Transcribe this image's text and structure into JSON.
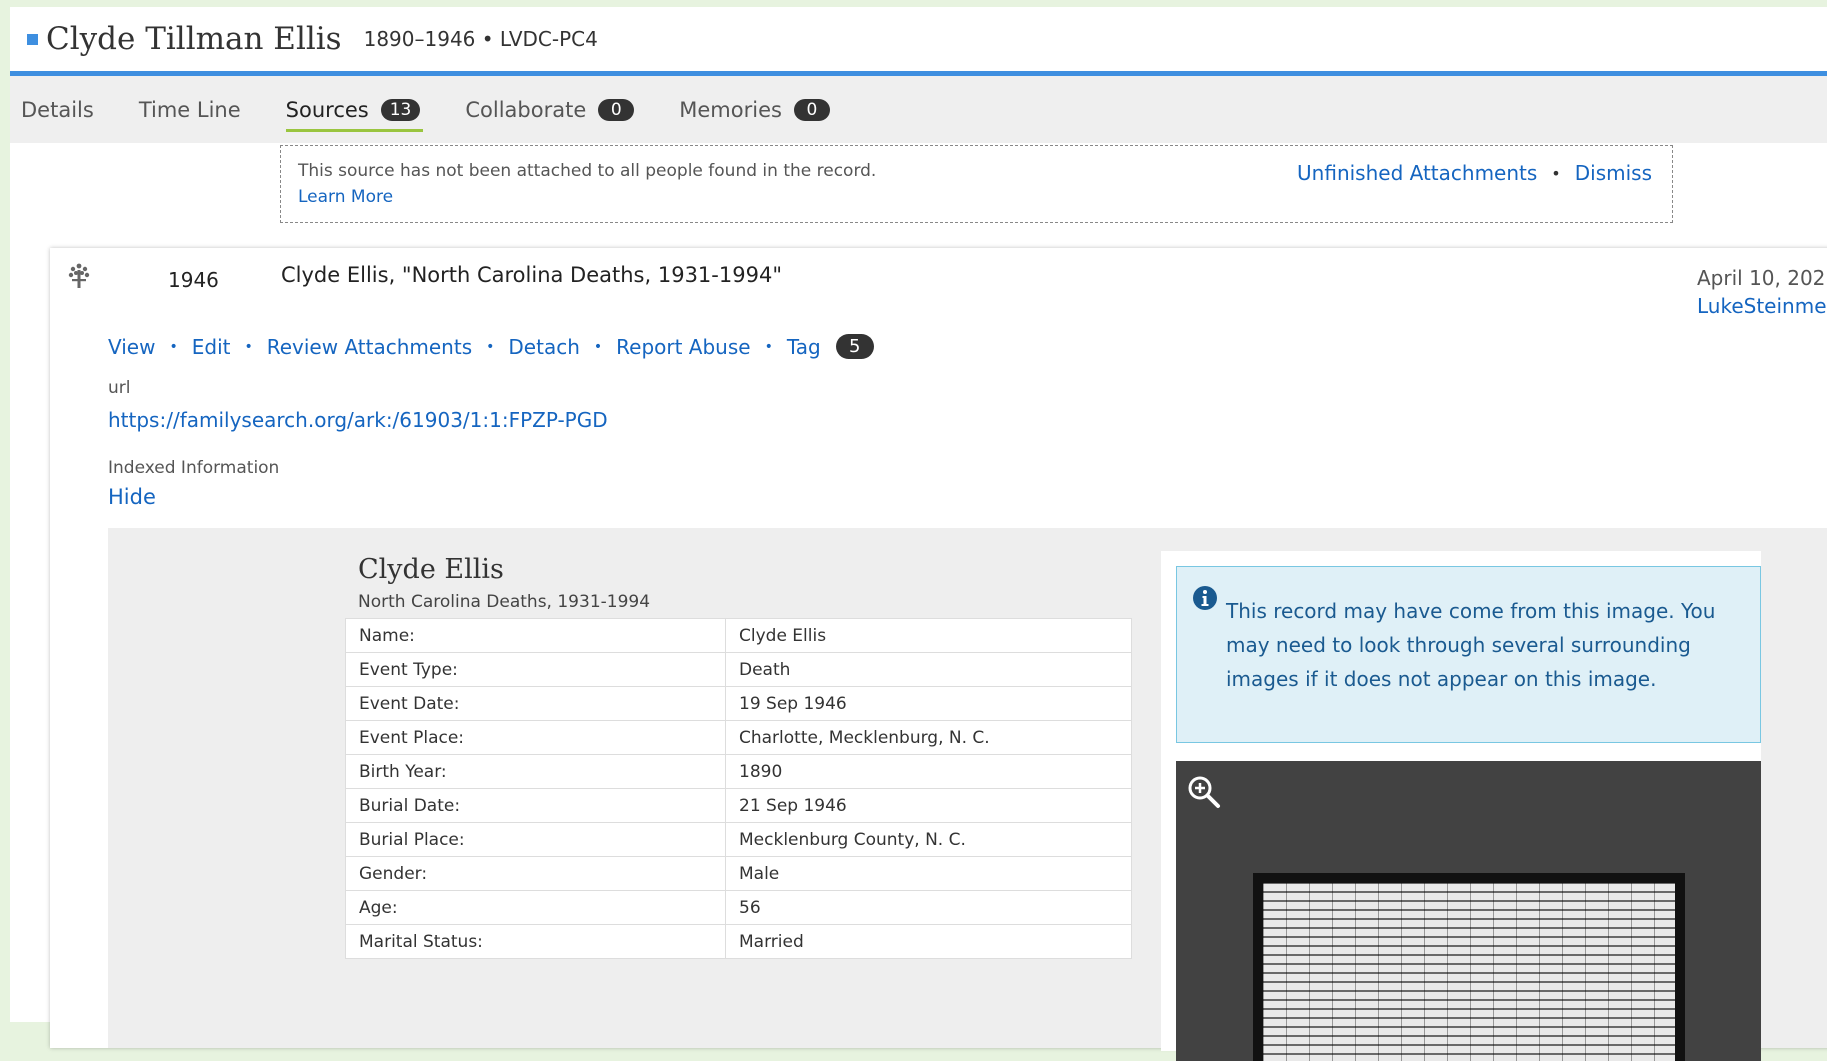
{
  "header": {
    "name": "Clyde Tillman Ellis",
    "meta": "1890–1946 • LVDC-PC4",
    "colors": {
      "accent": "#3e8fe0"
    }
  },
  "tabs": [
    {
      "label": "Details",
      "count": null
    },
    {
      "label": "Time Line",
      "count": null
    },
    {
      "label": "Sources",
      "count": "13",
      "active": true
    },
    {
      "label": "Collaborate",
      "count": "0"
    },
    {
      "label": "Memories",
      "count": "0"
    }
  ],
  "notice": {
    "message": "This source has not been attached to all people found in the record.",
    "learn_more": "Learn More",
    "unfinished": "Unfinished Attachments",
    "separator": "•",
    "dismiss": "Dismiss"
  },
  "source": {
    "icon": "tree-icon",
    "year": "1946",
    "title": "Clyde Ellis, \"North Carolina Deaths, 1931-1994\"",
    "date": "April 10, 202",
    "user": "LukeSteinme",
    "actions": [
      "View",
      "Edit",
      "Review Attachments",
      "Detach",
      "Report Abuse",
      "Tag"
    ],
    "action_separator": "•",
    "tag_count": "5",
    "url_label": "url",
    "url": "https://familysearch.org/ark:/61903/1:1:FPZP-PGD",
    "indexed_label": "Indexed Information",
    "hide_label": "Hide"
  },
  "record": {
    "name": "Clyde Ellis",
    "collection": "North Carolina Deaths, 1931-1994",
    "rows": [
      {
        "key": "Name:",
        "value": "Clyde Ellis"
      },
      {
        "key": "Event Type:",
        "value": "Death"
      },
      {
        "key": "Event Date:",
        "value": "19 Sep 1946"
      },
      {
        "key": "Event Place:",
        "value": "Charlotte, Mecklenburg, N. C."
      },
      {
        "key": "Birth Year:",
        "value": "1890"
      },
      {
        "key": "Burial Date:",
        "value": "21 Sep 1946"
      },
      {
        "key": "Burial Place:",
        "value": "Mecklenburg County, N. C."
      },
      {
        "key": "Gender:",
        "value": "Male"
      },
      {
        "key": "Age:",
        "value": "56"
      },
      {
        "key": "Marital Status:",
        "value": "Married"
      }
    ]
  },
  "image_panel": {
    "info_icon": "info-icon",
    "info_text": "This record may have come from this image. You may need to look through several surrounding images if it does not appear on this image.",
    "zoom_icon": "zoom-in-icon"
  }
}
